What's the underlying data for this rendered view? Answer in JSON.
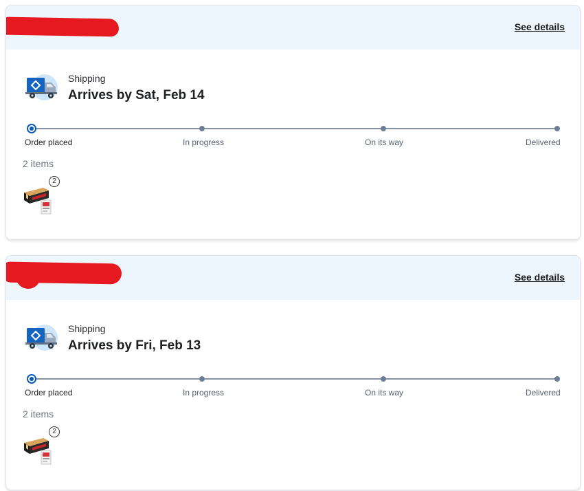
{
  "orders": [
    {
      "header": {
        "see_details_label": "See details"
      },
      "fulfillment": {
        "method": "Shipping",
        "arrival": "Arrives by Sat, Feb 14"
      },
      "progress": {
        "current_step": 0,
        "steps": [
          "Order placed",
          "In progress",
          "On its way",
          "Delivered"
        ]
      },
      "items": {
        "count_label": "2 items",
        "quantity_badge": "2"
      }
    },
    {
      "header": {
        "see_details_label": "See details"
      },
      "fulfillment": {
        "method": "Shipping",
        "arrival": "Arrives by Fri, Feb 13"
      },
      "progress": {
        "current_step": 0,
        "steps": [
          "Order placed",
          "In progress",
          "On its way",
          "Delivered"
        ]
      },
      "items": {
        "count_label": "2 items",
        "quantity_badge": "2"
      }
    }
  ],
  "icons": {
    "shipping": "delivery-truck-icon",
    "item_thumbnail": "product-thumbnail-icon"
  },
  "colors": {
    "accent": "#0a5bb5",
    "header_bg": "#eef6fd",
    "redaction": "#e5191f",
    "track": "#8593a5"
  }
}
